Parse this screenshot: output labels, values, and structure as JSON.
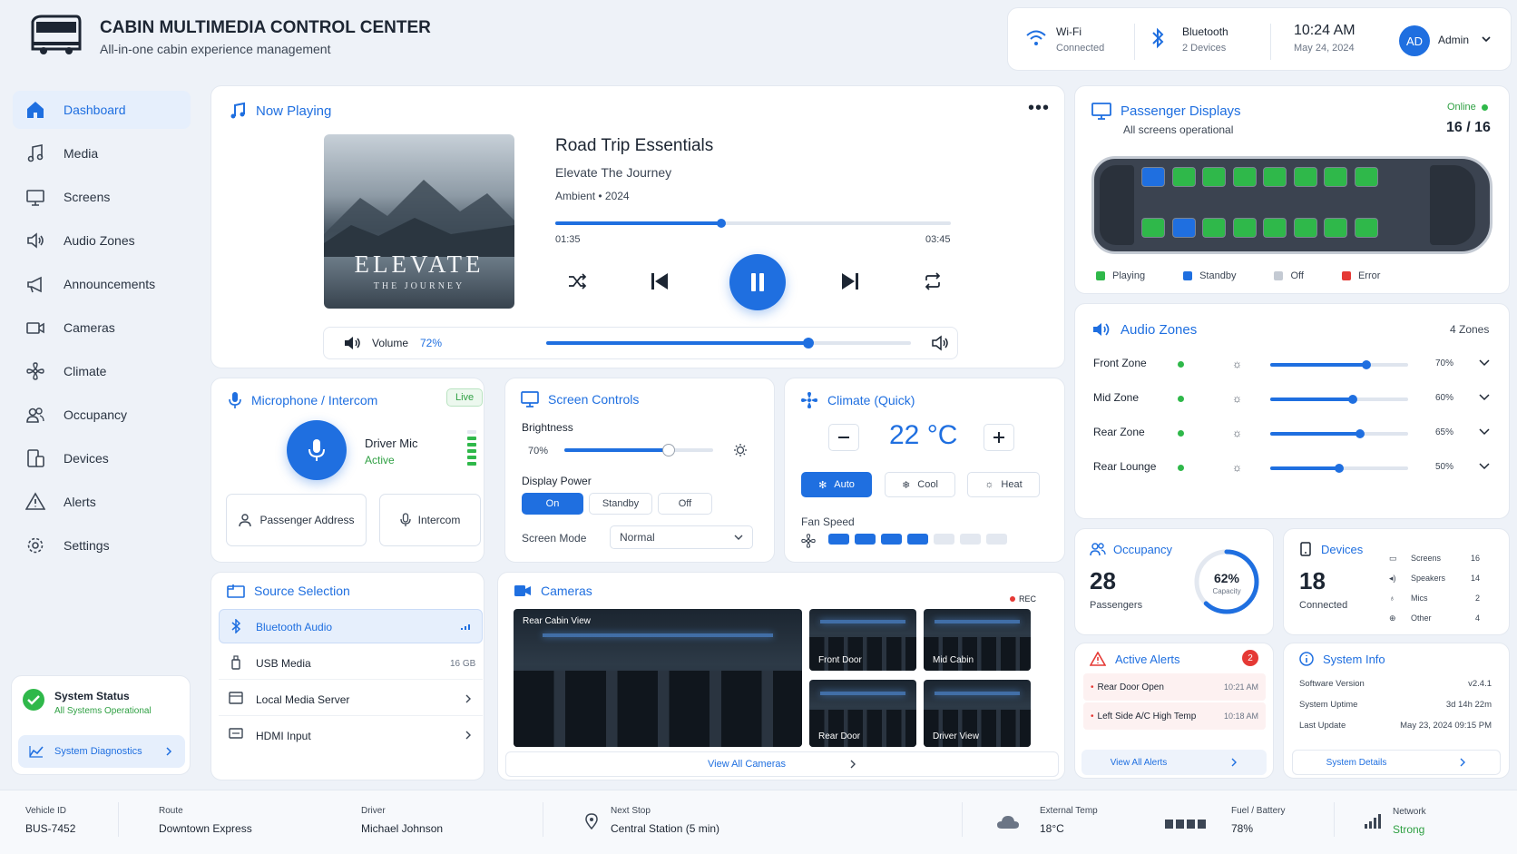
{
  "header": {
    "title": "CABIN MULTIMEDIA CONTROL CENTER",
    "subtitle": "All-in-one cabin experience management",
    "wifi_label": "Wi-Fi",
    "wifi_status": "Connected",
    "bt_label": "Bluetooth",
    "bt_status": "2 Devices",
    "time": "10:24 AM",
    "date": "May 24, 2024",
    "avatar": "AD",
    "user": "Admin"
  },
  "sidebar": {
    "items": [
      {
        "label": "Dashboard"
      },
      {
        "label": "Media"
      },
      {
        "label": "Screens"
      },
      {
        "label": "Audio Zones"
      },
      {
        "label": "Announcements"
      },
      {
        "label": "Cameras"
      },
      {
        "label": "Climate"
      },
      {
        "label": "Occupancy"
      },
      {
        "label": "Devices"
      },
      {
        "label": "Alerts"
      },
      {
        "label": "Settings"
      }
    ],
    "status_title": "System Status",
    "status_text": "All Systems Operational",
    "diag_label": "System Diagnostics"
  },
  "now_playing": {
    "title": "Now Playing",
    "album_art_title": "ELEVATE",
    "album_art_sub": "THE JOURNEY",
    "track": "Road Trip Essentials",
    "album": "Elevate The Journey",
    "genre": "Ambient",
    "year": "2024",
    "elapsed": "01:35",
    "duration": "03:45",
    "progress": 0.42,
    "volume_label": "Volume",
    "volume": "72%",
    "volume_value": 0.72
  },
  "displays": {
    "title": "Passenger Displays",
    "subtitle": "All screens operational",
    "online_label": "Online",
    "count": "16 / 16",
    "legend": [
      "Playing",
      "Standby",
      "Off",
      "Error"
    ],
    "colors": {
      "playing": "#2fb84a",
      "standby": "#1f6fe0",
      "off": "#c4cad3",
      "error": "#e53935"
    }
  },
  "audio_zones": {
    "title": "Audio Zones",
    "count": "4 Zones",
    "zones": [
      {
        "name": "Front Zone",
        "level": "70%",
        "value": 0.7
      },
      {
        "name": "Mid Zone",
        "level": "60%",
        "value": 0.6
      },
      {
        "name": "Rear Zone",
        "level": "65%",
        "value": 0.65
      },
      {
        "name": "Rear Lounge",
        "level": "50%",
        "value": 0.5
      }
    ]
  },
  "mic": {
    "title": "Microphone / Intercom",
    "badge": "Live",
    "name": "Driver Mic",
    "status": "Active",
    "btn1": "Passenger Address",
    "btn2": "Intercom"
  },
  "screen_controls": {
    "title": "Screen Controls",
    "brightness_label": "Brightness",
    "brightness": "70%",
    "brightness_value": 0.7,
    "power_label": "Display Power",
    "power_options": [
      "On",
      "Standby",
      "Off"
    ],
    "mode_label": "Screen Mode",
    "mode_value": "Normal"
  },
  "climate": {
    "title": "Climate (Quick)",
    "temp": "22 °C",
    "modes": [
      "Auto",
      "Cool",
      "Heat"
    ],
    "fan_label": "Fan Speed",
    "fan_level": 4,
    "fan_max": 7
  },
  "source": {
    "title": "Source Selection",
    "items": [
      {
        "label": "Bluetooth Audio",
        "meta": ""
      },
      {
        "label": "USB Media",
        "meta": "16 GB"
      },
      {
        "label": "Local Media Server",
        "meta": ""
      },
      {
        "label": "HDMI Input",
        "meta": ""
      }
    ]
  },
  "cameras": {
    "title": "Cameras",
    "rec": "REC",
    "views": [
      "Rear Cabin View",
      "Front Door",
      "Mid Cabin",
      "Rear Door",
      "Driver View"
    ],
    "view_all": "View All Cameras"
  },
  "occupancy": {
    "title": "Occupancy",
    "count": "28",
    "label": "Passengers",
    "pct": "62%",
    "pct_label": "Capacity",
    "value": 0.62
  },
  "devices": {
    "title": "Devices",
    "count": "18",
    "label": "Connected",
    "list": [
      {
        "name": "Screens",
        "n": "16"
      },
      {
        "name": "Speakers",
        "n": "14"
      },
      {
        "name": "Mics",
        "n": "2"
      },
      {
        "name": "Other",
        "n": "4"
      }
    ]
  },
  "alerts": {
    "title": "Active Alerts",
    "badge": "2",
    "items": [
      {
        "text": "Rear Door Open",
        "time": "10:21 AM"
      },
      {
        "text": "Left Side A/C High Temp",
        "time": "10:18 AM"
      }
    ],
    "view_all": "View All Alerts"
  },
  "sysinfo": {
    "title": "System Info",
    "rows": [
      {
        "k": "Software Version",
        "v": "v2.4.1"
      },
      {
        "k": "System Uptime",
        "v": "3d 14h 22m"
      },
      {
        "k": "Last Update",
        "v": "May 23, 2024 09:15 PM"
      }
    ],
    "details": "System Details"
  },
  "footer": {
    "vehicle_label": "Vehicle ID",
    "vehicle": "BUS-7452",
    "route_label": "Route",
    "route": "Downtown Express",
    "driver_label": "Driver",
    "driver": "Michael Johnson",
    "stop_label": "Next Stop",
    "stop": "Central Station (5 min)",
    "temp_label": "External Temp",
    "temp": "18°C",
    "fuel_label": "Fuel / Battery",
    "fuel": "78%",
    "net_label": "Network",
    "net": "Strong"
  }
}
